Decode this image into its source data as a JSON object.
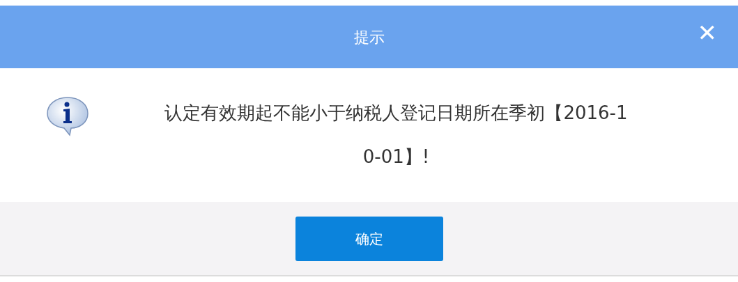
{
  "dialog": {
    "title": "提示",
    "close": "✕",
    "message_lines": [
      "认定有效期起不能小于纳税人登记日期所在季初【2016-1",
      "0-01】!"
    ],
    "buttons": [
      "确定"
    ]
  }
}
